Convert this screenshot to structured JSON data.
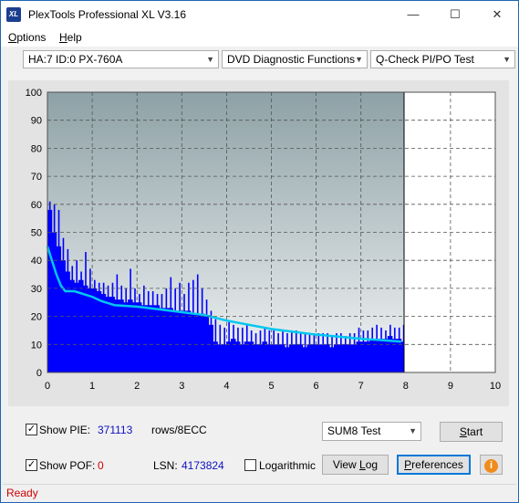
{
  "window": {
    "title": "PlexTools Professional XL V3.16",
    "icon_text": "XL",
    "controls": {
      "minimize": "—",
      "maximize": "☐",
      "close": "✕"
    }
  },
  "menu": {
    "options_u": "O",
    "options_rest": "ptions",
    "help_u": "H",
    "help_rest": "elp"
  },
  "toolbar": {
    "drive": "HA:7 ID:0  PX-760A",
    "function": "DVD Diagnostic Functions",
    "test": "Q-Check PI/PO Test"
  },
  "chart_data": {
    "type": "area",
    "x_ticks": [
      "0",
      "1",
      "2",
      "3",
      "4",
      "5",
      "6",
      "7",
      "8",
      "9",
      "10"
    ],
    "y_ticks": [
      "0",
      "10",
      "20",
      "30",
      "40",
      "50",
      "60",
      "70",
      "80",
      "90",
      "100"
    ],
    "xlim": [
      0,
      10
    ],
    "ylim": [
      0,
      100
    ],
    "grid": true,
    "data_end_x": 8,
    "series": [
      {
        "kind": "bars",
        "color": "#0000ff",
        "x": [
          0.0,
          0.1,
          0.2,
          0.3,
          0.4,
          0.5,
          0.6,
          0.7,
          0.8,
          0.9,
          1.0,
          1.1,
          1.2,
          1.3,
          1.4,
          1.5,
          1.6,
          1.7,
          1.8,
          1.9,
          2.0,
          2.1,
          2.2,
          2.3,
          2.4,
          2.5,
          2.6,
          2.7,
          2.8,
          2.9,
          3.0,
          3.1,
          3.2,
          3.3,
          3.4,
          3.5,
          3.6,
          3.7,
          3.8,
          3.9,
          4.0,
          4.1,
          4.2,
          4.3,
          4.4,
          4.5,
          4.6,
          4.7,
          4.8,
          4.9,
          5.0,
          5.1,
          5.2,
          5.3,
          5.4,
          5.5,
          5.6,
          5.7,
          5.8,
          5.9,
          6.0,
          6.1,
          6.2,
          6.3,
          6.4,
          6.5,
          6.6,
          6.7,
          6.8,
          6.9,
          7.0,
          7.1,
          7.2,
          7.3,
          7.4,
          7.5,
          7.6,
          7.7,
          7.8,
          7.9,
          8.0
        ],
        "values": [
          58,
          50,
          45,
          40,
          36,
          33,
          32,
          33,
          31,
          30,
          30,
          29,
          28,
          27,
          27,
          26,
          26,
          25,
          26,
          25,
          25,
          24,
          24,
          24,
          24,
          23,
          23,
          23,
          22,
          22,
          22,
          22,
          21,
          21,
          21,
          20,
          17,
          11,
          10,
          10,
          11,
          12,
          11,
          10,
          11,
          11,
          10,
          10,
          11,
          10,
          10,
          10,
          10,
          9,
          10,
          10,
          10,
          9,
          10,
          10,
          10,
          10,
          10,
          9,
          10,
          10,
          10,
          10,
          10,
          11,
          11,
          11,
          12,
          12,
          12,
          12,
          13,
          12,
          12,
          11,
          3
        ],
        "peaks": [
          61,
          60,
          58,
          48,
          44,
          38,
          40,
          36,
          43,
          37,
          33,
          32,
          32,
          31,
          32,
          35,
          31,
          30,
          37,
          30,
          28,
          31,
          29,
          29,
          28,
          28,
          30,
          34,
          30,
          32,
          28,
          32,
          33,
          35,
          30,
          26,
          22,
          19,
          17,
          16,
          18,
          17,
          16,
          16,
          17,
          15,
          14,
          15,
          16,
          15,
          15,
          14,
          15,
          14,
          15,
          15,
          14,
          14,
          14,
          14,
          14,
          14,
          14,
          13,
          14,
          14,
          13,
          14,
          14,
          16,
          15,
          15,
          16,
          17,
          16,
          15,
          17,
          16,
          16,
          17,
          7
        ]
      },
      {
        "kind": "line",
        "color": "#00c8f0",
        "x": [
          0.0,
          0.1,
          0.2,
          0.3,
          0.4,
          0.5,
          0.6,
          0.7,
          0.8,
          1.0,
          1.2,
          1.5,
          2.0,
          2.5,
          3.0,
          3.5,
          4.0,
          4.5,
          5.0,
          5.5,
          6.0,
          6.5,
          7.0,
          7.5,
          7.9
        ],
        "values": [
          45,
          40,
          35,
          31,
          29,
          29,
          29,
          28.5,
          28,
          27,
          25.5,
          24,
          23.5,
          22.5,
          21.5,
          20.5,
          18.5,
          17,
          15.5,
          14.5,
          13.5,
          12.8,
          12,
          11.5,
          11
        ]
      }
    ]
  },
  "controls": {
    "show_pie_label": "Show PIE:",
    "pie_value": "371113",
    "pie_unit": "rows/8ECC",
    "show_pof_label": "Show POF:",
    "pof_value": "0",
    "lsn_label": "LSN:",
    "lsn_value": "4173824",
    "logarithmic_label": "Logarithmic",
    "test_mode": "SUM8 Test",
    "start_u": "S",
    "start_rest": "tart",
    "viewlog_pre": "View ",
    "viewlog_u": "L",
    "viewlog_rest": "og",
    "prefs_u": "P",
    "prefs_rest": "references",
    "info_icon": "i",
    "check": "✓"
  },
  "status": {
    "text": "Ready"
  },
  "colors": {
    "pie": "#1010c0",
    "pof": "#d00000",
    "lsn": "#1010c0",
    "status": "#d00000"
  }
}
